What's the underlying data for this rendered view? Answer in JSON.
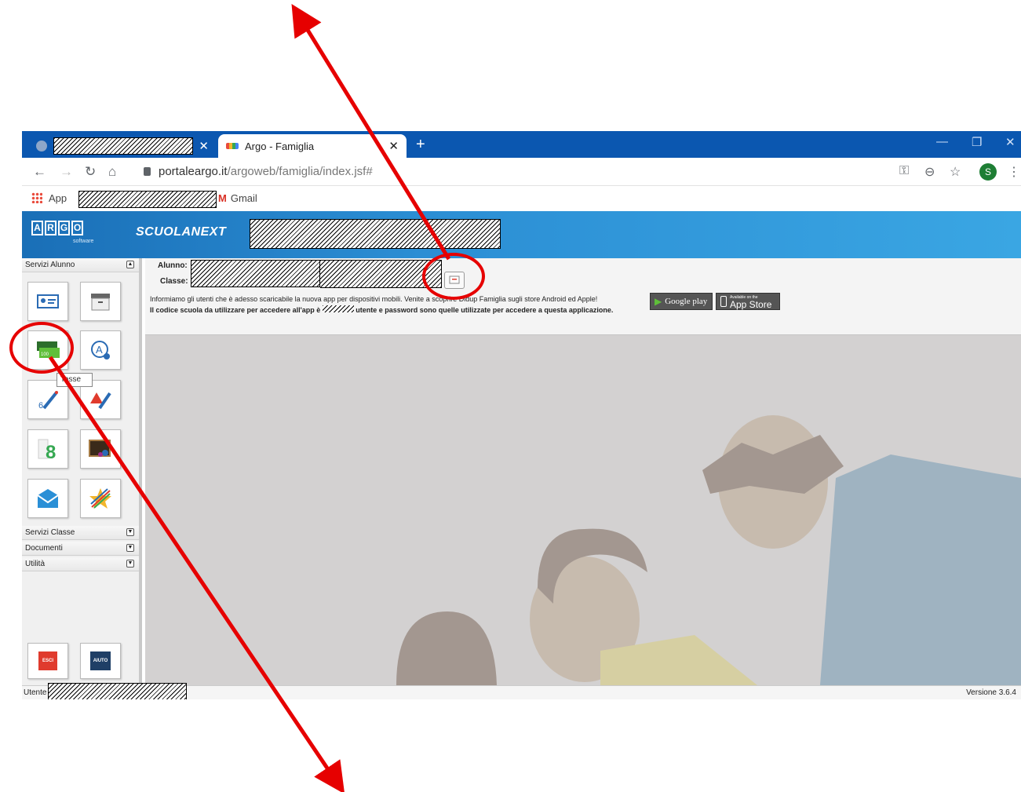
{
  "browser": {
    "tab1_title": "",
    "tab2_title": "Argo - Famiglia",
    "new_tab": "+",
    "url_host": "portaleargo.it",
    "url_path": "/argoweb/famiglia/index.jsf#",
    "profile_initial": "S",
    "bookmarks": {
      "apps": "App",
      "gmail": "Gmail"
    }
  },
  "app": {
    "logo_letters": [
      "A",
      "R",
      "G",
      "O"
    ],
    "logo_sub": "software",
    "product": "SCUOLANEXT",
    "sidebar": {
      "sections": [
        "Servizi Alunno",
        "Servizi Classe",
        "Documenti",
        "Utilità"
      ],
      "tooltip": "Tasse",
      "exit_label": "ESCI",
      "help_label": "AIUTO"
    },
    "student": {
      "alunno_label": "Alunno:",
      "classe_label": "Classe:"
    },
    "info_line1": "Informiamo gli utenti che è adesso scaricabile la nuova app per dispositivi mobili. Venite a scoprire Didup Famiglia sugli store Android ed Apple!",
    "info_line2_a": "Il codice scuola da utilizzare per accedere all'app è",
    "info_line2_b": "utente e password sono quelle utilizzate per accedere a questa applicazione.",
    "google_play": "Google play",
    "app_store_small": "Available on the",
    "app_store": "App Store",
    "user_label": "Utente",
    "version": "Versione 3.6.4"
  },
  "colors": {
    "annotation": "#e60000",
    "tabbar": "#0b57b0"
  }
}
